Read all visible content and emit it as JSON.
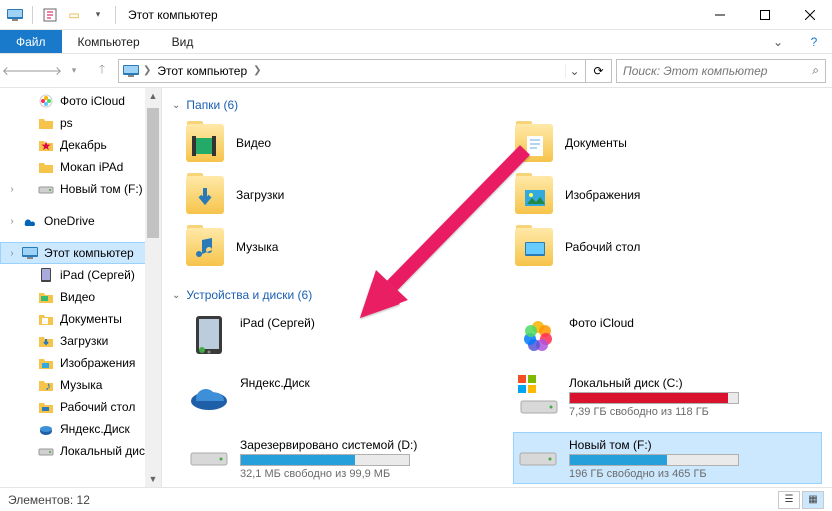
{
  "window": {
    "title": "Этот компьютер"
  },
  "ribbon": {
    "file": "Файл",
    "tabs": [
      "Компьютер",
      "Вид"
    ]
  },
  "address": {
    "location": "Этот компьютер",
    "search_placeholder": "Поиск: Этот компьютер"
  },
  "nav": {
    "items": [
      {
        "label": "Фото iCloud",
        "icon": "photos",
        "sub": true
      },
      {
        "label": "ps",
        "icon": "folder",
        "sub": true
      },
      {
        "label": "Декабрь",
        "icon": "folder-star",
        "sub": true
      },
      {
        "label": "Мокап iPAd",
        "icon": "folder",
        "sub": true
      },
      {
        "label": "Новый том (F:)",
        "icon": "drive",
        "sub": true,
        "expandable": true
      },
      {
        "label": "OneDrive",
        "icon": "onedrive",
        "sub": false,
        "gap": true,
        "expandable": true
      },
      {
        "label": "Этот компьютер",
        "icon": "pc",
        "sub": false,
        "active": true,
        "gap": true,
        "expandable": true
      },
      {
        "label": "iPad (Сергей)",
        "icon": "ipad",
        "sub": true
      },
      {
        "label": "Видео",
        "icon": "video",
        "sub": true
      },
      {
        "label": "Документы",
        "icon": "docs",
        "sub": true
      },
      {
        "label": "Загрузки",
        "icon": "downloads",
        "sub": true
      },
      {
        "label": "Изображения",
        "icon": "images",
        "sub": true
      },
      {
        "label": "Музыка",
        "icon": "music",
        "sub": true
      },
      {
        "label": "Рабочий стол",
        "icon": "desktop",
        "sub": true
      },
      {
        "label": "Яндекс.Диск",
        "icon": "yadisk",
        "sub": true
      },
      {
        "label": "Локальный диск (",
        "icon": "drive",
        "sub": true
      }
    ]
  },
  "groups": {
    "folders_title": "Папки (6)",
    "drives_title": "Устройства и диски (6)"
  },
  "folders": [
    {
      "label": "Видео",
      "icon": "video"
    },
    {
      "label": "Документы",
      "icon": "docs"
    },
    {
      "label": "Загрузки",
      "icon": "downloads"
    },
    {
      "label": "Изображения",
      "icon": "images"
    },
    {
      "label": "Музыка",
      "icon": "music"
    },
    {
      "label": "Рабочий стол",
      "icon": "desktop"
    }
  ],
  "drives": [
    {
      "label": "iPad (Сергей)",
      "icon": "ipad",
      "bar": false
    },
    {
      "label": "Фото iCloud",
      "icon": "photos",
      "bar": false
    },
    {
      "label": "Яндекс.Диск",
      "icon": "yadisk",
      "bar": false
    },
    {
      "label": "Локальный диск (C:)",
      "icon": "windrive",
      "bar": true,
      "fill": 94,
      "color": "#d9132e",
      "free": "7,39 ГБ свободно из 118 ГБ"
    },
    {
      "label": "Зарезервировано системой (D:)",
      "icon": "drive",
      "bar": true,
      "fill": 68,
      "color": "#26a0da",
      "free": "32,1 МБ свободно из 99,9 МБ"
    },
    {
      "label": "Новый том (F:)",
      "icon": "drive",
      "bar": true,
      "fill": 58,
      "color": "#26a0da",
      "free": "196 ГБ свободно из 465 ГБ",
      "selected": true
    }
  ],
  "status": {
    "text": "Элементов: 12"
  }
}
